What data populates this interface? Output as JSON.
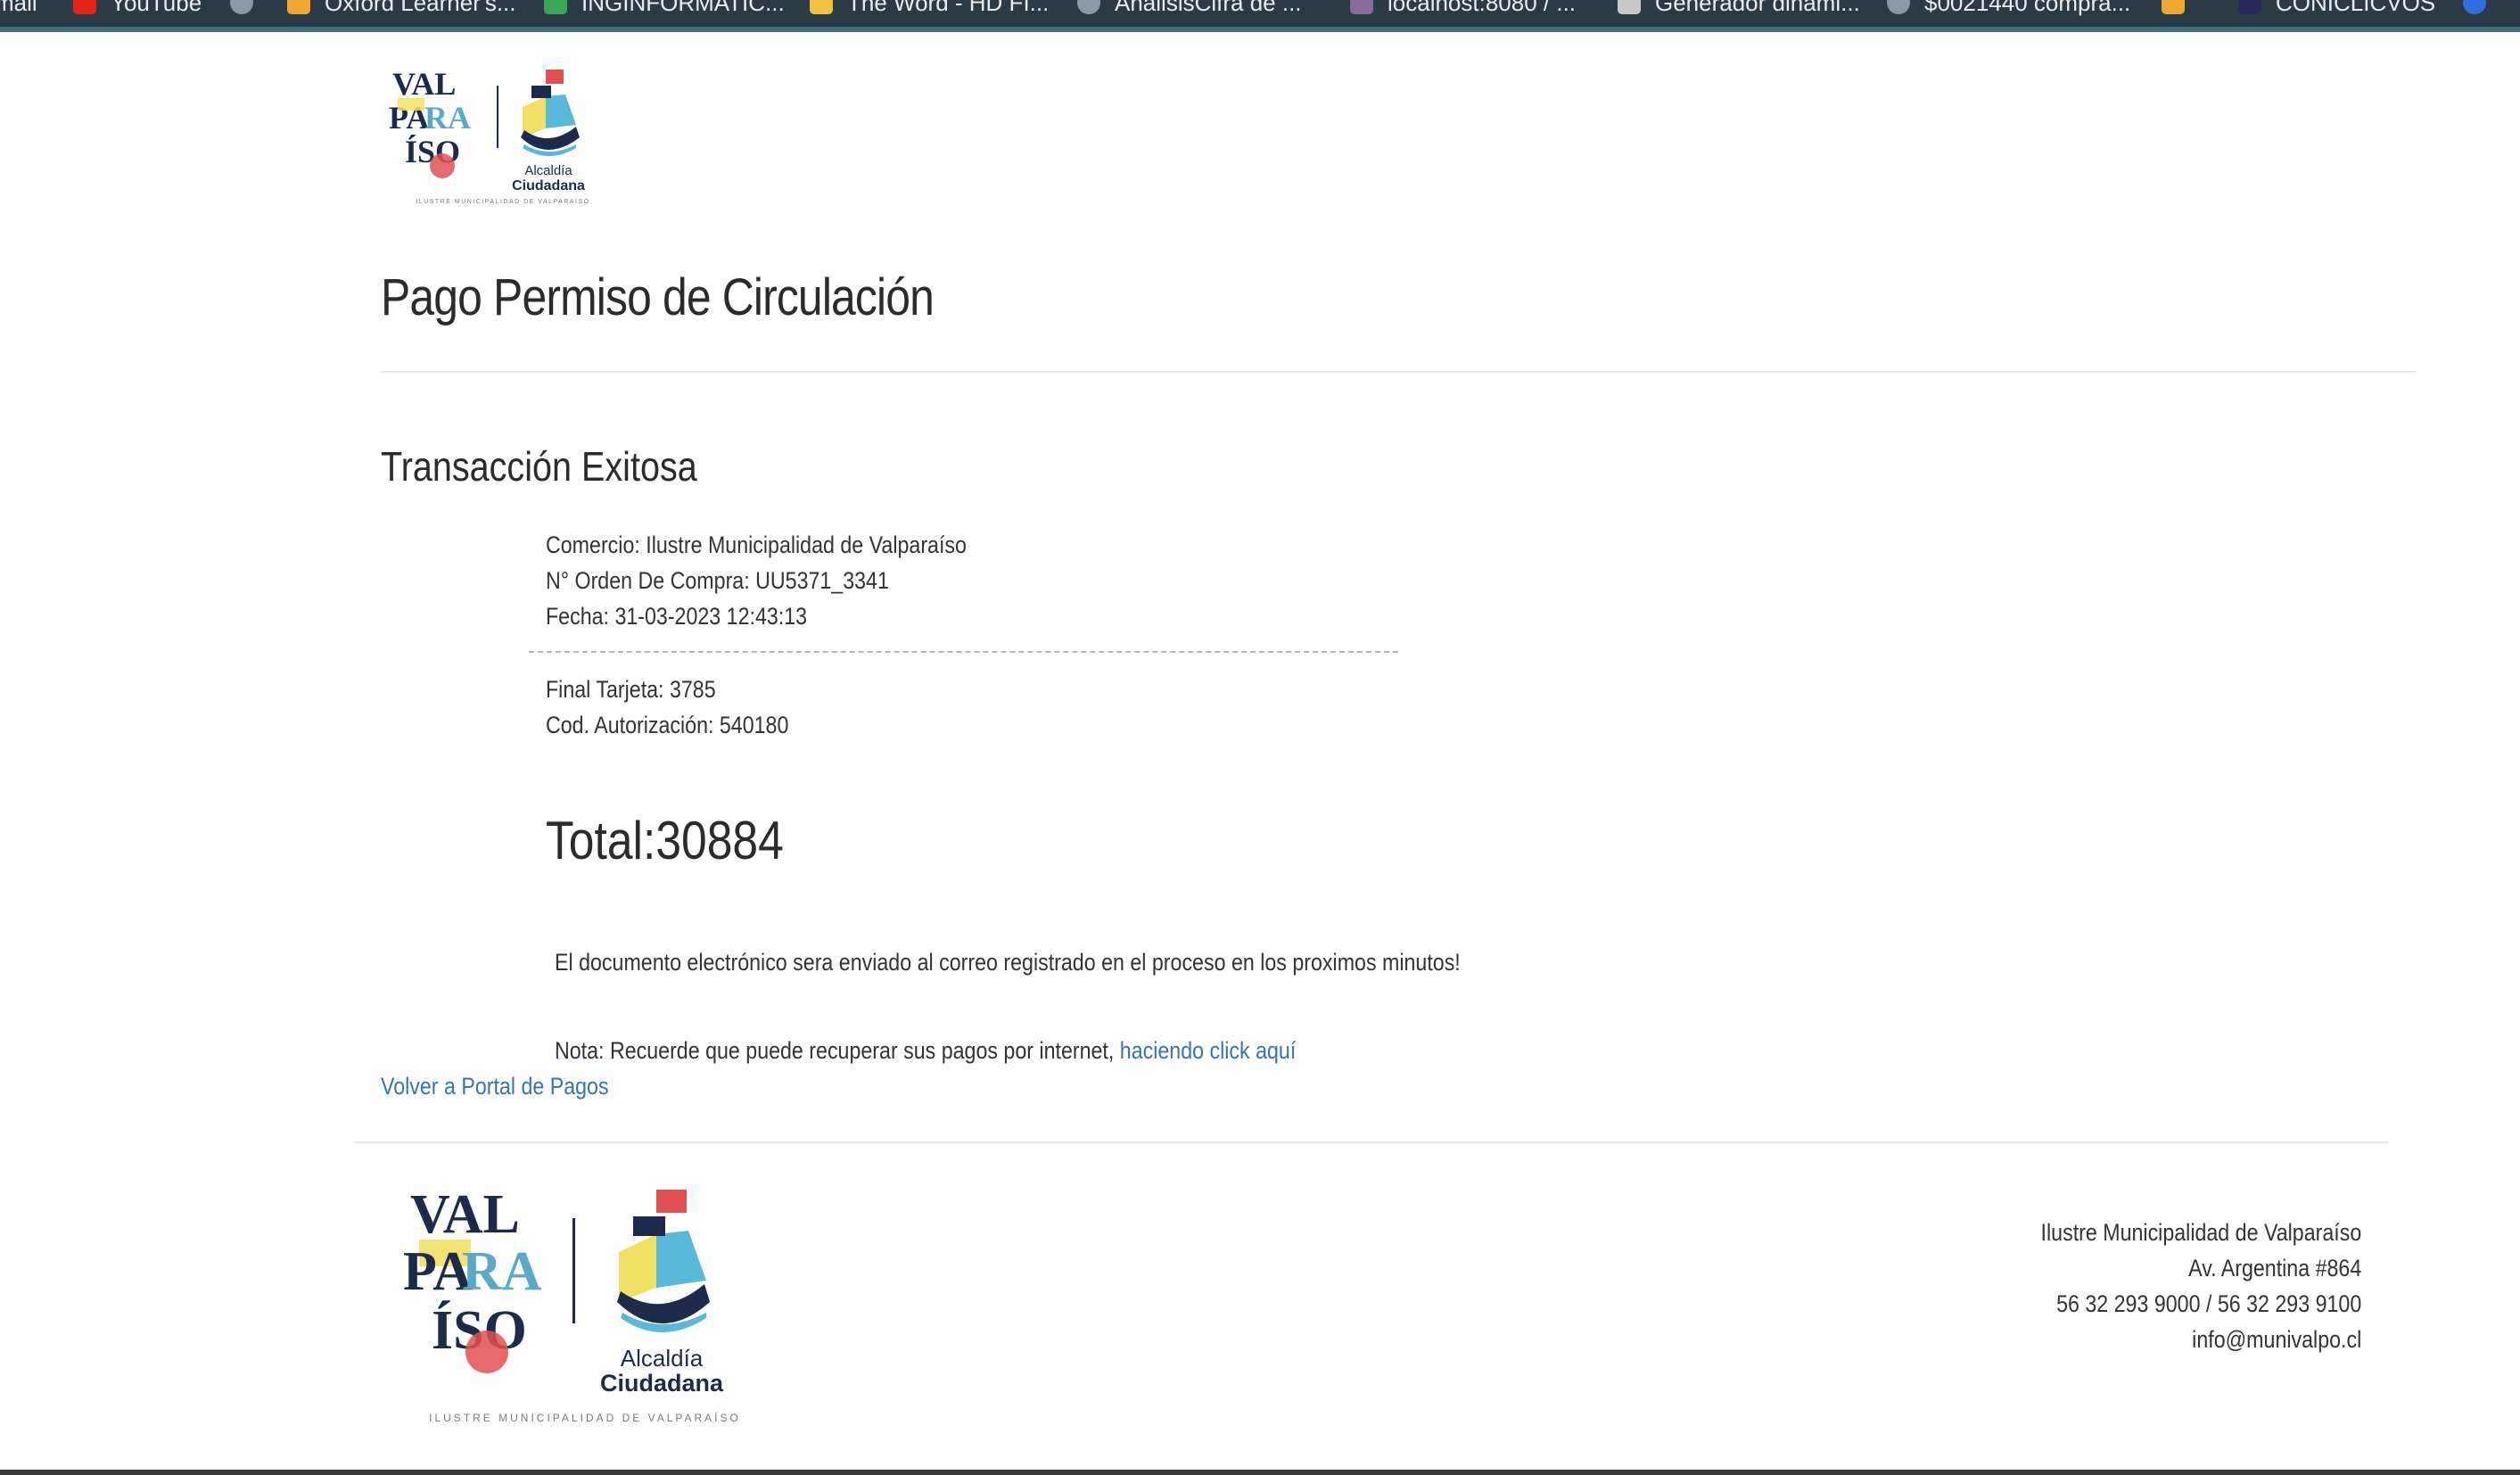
{
  "browser": {
    "bookmarks": [
      {
        "label": "mail",
        "icon": "none"
      },
      {
        "label": "YouTube",
        "icon": "youtube-icon",
        "color": "#e62117"
      },
      {
        "label": "Oxford Learner's...",
        "icon": "generic-favicon",
        "color": "#f0a830"
      },
      {
        "label": "INGINFORMATIC...",
        "icon": "generic-favicon",
        "color": "#3aa655"
      },
      {
        "label": "The Word - HD FI...",
        "icon": "generic-favicon",
        "color": "#f0c040"
      },
      {
        "label": "AnalisisCifra de ...",
        "icon": "globe-icon",
        "color": "#8a9aa3"
      },
      {
        "label": "localhost:8080 / ...",
        "icon": "generic-favicon",
        "color": "#8a6a9a"
      },
      {
        "label": "Generador dinami...",
        "icon": "generic-favicon",
        "color": "#c8c8c8"
      },
      {
        "label": "$0021440 compra...",
        "icon": "globe-icon",
        "color": "#8a9aa3"
      },
      {
        "label": "",
        "icon": "generic-favicon",
        "color": "#f0a830"
      },
      {
        "label": "CONICLICVOS",
        "icon": "generic-favicon",
        "color": "#2a2a5a"
      },
      {
        "label": "",
        "icon": "generic-favicon",
        "color": "#2f6fe0"
      }
    ]
  },
  "brand": {
    "logo_text_main": "VALPARAÍSO",
    "logo_text_sub": "ILUSTRE MUNICIPALIDAD DE VALPARAÍSO",
    "logo_alcaldia_line1": "Alcaldía",
    "logo_alcaldia_line2": "Ciudadana"
  },
  "page": {
    "title": "Pago Permiso de Circulación",
    "section_title": "Transacción Exitosa"
  },
  "transaction": {
    "comercio": "Comercio: Ilustre Municipalidad de Valparaíso",
    "orden": "N° Orden De Compra: UU5371_3341",
    "fecha": "Fecha: 31-03-2023 12:43:13",
    "tarjeta": "Final Tarjeta: 3785",
    "autorizacion": "Cod. Autorización: 540180",
    "total": "Total:30884"
  },
  "messages": {
    "documento": "El documento electrónico sera enviado al correo registrado en el proceso en los proximos minutos!",
    "nota_prefix": "Nota: Recuerde que puede recuperar sus pagos por internet, ",
    "nota_link": "haciendo click aquí",
    "volver": "Volver a Portal de Pagos"
  },
  "footer": {
    "org": "Ilustre Municipalidad de Valparaíso",
    "address": "Av. Argentina #864",
    "phones": "56 32 293 9000 / 56 32 293 9100",
    "email": "info@munivalpo.cl"
  },
  "colors": {
    "link": "#3573b5",
    "bookmarks_bar": "#2a3b45",
    "accent_teal": "#3f6e7d"
  }
}
